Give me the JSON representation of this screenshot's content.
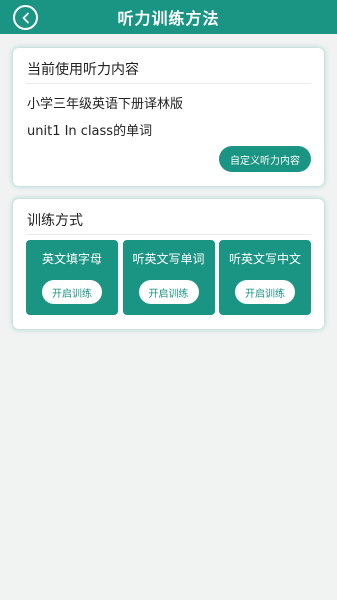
{
  "header": {
    "title": "听力训练方法",
    "back_icon": "chevron-left-icon"
  },
  "content_card": {
    "title": "当前使用听力内容",
    "book": "小学三年级英语下册译林版",
    "unit": "unit1 In class的单词",
    "custom_button": "自定义听力内容"
  },
  "mode_card": {
    "title": "训练方式",
    "modes": [
      {
        "label": "英文填字母",
        "button": "开启训练"
      },
      {
        "label": "听英文写单词",
        "button": "开启训练"
      },
      {
        "label": "听英文写中文",
        "button": "开启训练"
      }
    ]
  },
  "colors": {
    "accent": "#1a9483",
    "background": "#f1f3f3"
  }
}
